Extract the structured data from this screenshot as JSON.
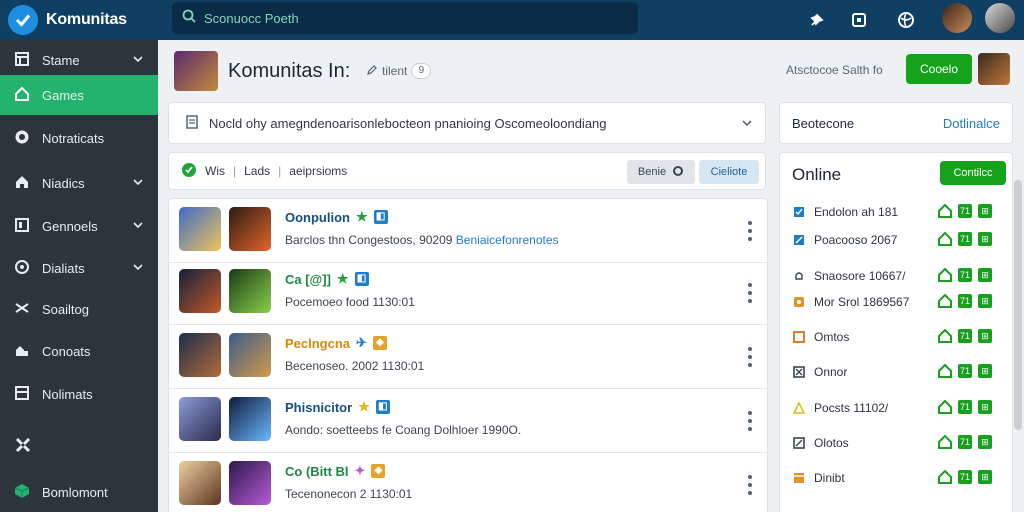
{
  "brand": {
    "title": "Komunitas"
  },
  "search": {
    "placeholder": "Sconuocc Poeth"
  },
  "sidebar": {
    "items": [
      {
        "label": "Stame",
        "icon": "dashboard-icon",
        "chevron": true
      },
      {
        "label": "Games",
        "icon": "home-icon",
        "chevron": false,
        "active": true
      },
      {
        "label": "Notraticats",
        "icon": "chat-icon",
        "chevron": false
      },
      {
        "label": "Niadics",
        "icon": "house-icon",
        "chevron": true
      },
      {
        "label": "Gennoels",
        "icon": "panel-icon",
        "chevron": true
      },
      {
        "label": "Dialiats",
        "icon": "location-icon",
        "chevron": true
      },
      {
        "label": "Soailtog",
        "icon": "shuffle-icon",
        "chevron": false
      },
      {
        "label": "Conoats",
        "icon": "users-icon",
        "chevron": false
      },
      {
        "label": "Nolimats",
        "icon": "table-icon",
        "chevron": false
      },
      {
        "label": "",
        "icon": "puzzle-icon",
        "chevron": false
      },
      {
        "label": "Bomlomont",
        "icon": "cube-icon",
        "chevron": false
      }
    ]
  },
  "header": {
    "title": "Komunitas In:",
    "edit_label": "tilent",
    "edit_count": "9",
    "meta": "Atsctocoe  Salth fo",
    "cta_label": "Cooelo"
  },
  "announcement": {
    "text": "Nocld ohy amegndenoarisonlebocteon pnanioing Oscomeoloondiang"
  },
  "filters": {
    "label_a": "Wis",
    "label_b": "Lads",
    "label_c": "aeiprsioms",
    "chip_a": "Benie",
    "chip_b": "Cieliote"
  },
  "feed": [
    {
      "name": "Oonpulion",
      "name_color": "#17507e",
      "sub": "Barclos thn Congestoos, 90209",
      "link": "Beniaicefonrenotes"
    },
    {
      "name": "Ca [@]]",
      "name_color": "#1b8a45",
      "sub": "Pocemoeo food 1130:01",
      "link": ""
    },
    {
      "name": "Peclngcna",
      "name_color": "#d88a0c",
      "sub": "Becenoseo. 2002 1130:01",
      "link": ""
    },
    {
      "name": "Phisnicitor",
      "name_color": "#17507e",
      "sub": "Aondo: soetteebs fe Coang Dolhloer 1990O.",
      "link": ""
    },
    {
      "name": "Co (Bitt  Bl",
      "name_color": "#1b8a45",
      "sub": "Tecenonecon 2 1130:01",
      "link": ""
    }
  ],
  "right_top": {
    "left": "Beotecone",
    "right": "Dotlinalce"
  },
  "online": {
    "title": "Online",
    "button": "Contilcc",
    "rows": [
      {
        "label": "Endolon ah 181",
        "icon": "check-square-icon",
        "color": "#1f7ec8"
      },
      {
        "label": "Poacooso 2067",
        "icon": "edit-square-icon",
        "color": "#1f7ec8"
      },
      {
        "label": "Snaosore 10667/",
        "icon": "bell-icon",
        "color": "#3b4651"
      },
      {
        "label": "Mor Srol 1869567",
        "icon": "badge-icon",
        "color": "#e0932a"
      },
      {
        "label": "Omtos",
        "icon": "ticket-icon",
        "color": "#e07a2a"
      },
      {
        "label": "Onnor",
        "icon": "box-x-icon",
        "color": "#3b4651"
      },
      {
        "label": "Pocsts 11102/",
        "icon": "warning-icon",
        "color": "#d4c21b"
      },
      {
        "label": "Olotos",
        "icon": "grid-icon",
        "color": "#3b4651"
      },
      {
        "label": "Dinibt",
        "icon": "calendar-icon",
        "color": "#e0932a"
      }
    ]
  }
}
